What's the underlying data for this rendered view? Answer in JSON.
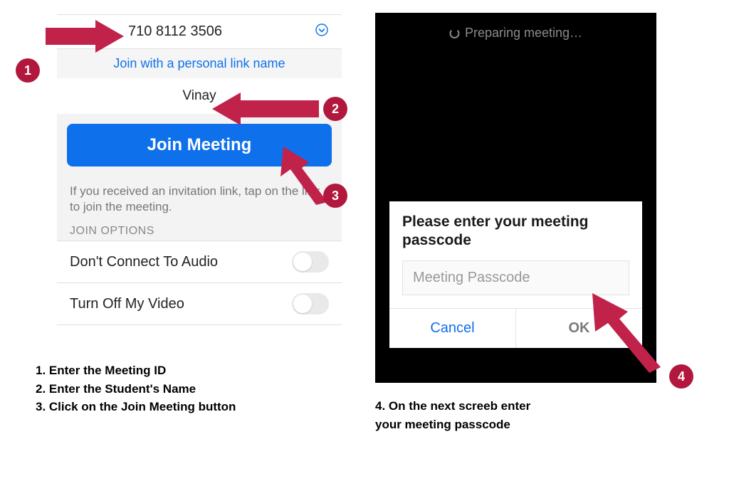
{
  "leftScreen": {
    "meetingId": "710 8112 3506",
    "personalLinkText": "Join with a personal link name",
    "nameValue": "Vinay",
    "joinButtonLabel": "Join Meeting",
    "hintText": "If you received an invitation link, tap on the link to join the meeting.",
    "joinOptionsLabel": "JOIN OPTIONS",
    "option1": "Don't Connect To Audio",
    "option2": "Turn Off My Video"
  },
  "rightScreen": {
    "preparingText": "Preparing meeting…",
    "dialogTitle": "Please enter your meeting passcode",
    "passcodePlaceholder": "Meeting Passcode",
    "cancelLabel": "Cancel",
    "okLabel": "OK"
  },
  "instructionsLeft": {
    "line1": "1. Enter the Meeting ID",
    "line2": "2. Enter the Student's Name",
    "line3": "3. Click on the Join Meeting button"
  },
  "instructionsRight": {
    "line1": "4. On the next screeb enter",
    "line2": "your meeting passcode"
  },
  "badges": {
    "b1": "1",
    "b2": "2",
    "b3": "3",
    "b4": "4"
  },
  "colors": {
    "accent": "#0e71eb",
    "badge": "#b2173e"
  }
}
